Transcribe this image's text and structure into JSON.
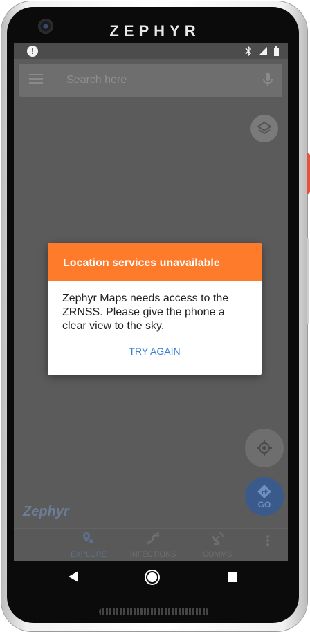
{
  "device": {
    "brand": "ZEPHYR"
  },
  "status_bar": {
    "alert_icon": "!",
    "icons": [
      "bluetooth-icon",
      "signal-icon",
      "battery-icon"
    ]
  },
  "search": {
    "placeholder": "Search here",
    "icons": [
      "menu-icon",
      "mic-icon"
    ]
  },
  "map_controls": {
    "layers_icon": "layers-icon",
    "locate_icon": "crosshair-icon",
    "go_label": "GO"
  },
  "watermark": "Zephyr",
  "dialog": {
    "title": "Location services unavailable",
    "message": "Zephyr Maps needs access to the ZRNSS. Please give the phone a clear view to the sky.",
    "action": "TRY AGAIN",
    "header_color": "#ff7b2c",
    "action_color": "#3a7fd5"
  },
  "bottom_nav": {
    "items": [
      {
        "label": "EXPLORE",
        "icon": "map-pin-icon",
        "active": true
      },
      {
        "label": "INFECTIONS",
        "icon": "dna-icon",
        "active": false
      },
      {
        "label": "COMMS",
        "icon": "satellite-dish-icon",
        "active": false
      }
    ],
    "more_icon": "more-vert-icon"
  },
  "system_nav": [
    "back-icon",
    "home-icon",
    "recents-icon"
  ]
}
